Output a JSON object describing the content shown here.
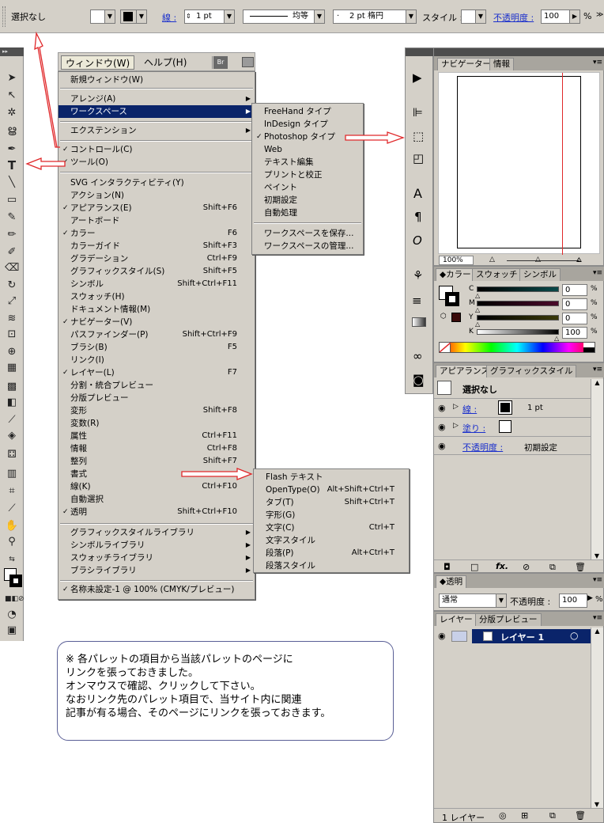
{
  "control_bar": {
    "selection_label": "選択なし",
    "stroke_label": "線 :",
    "stroke_weight": "1 pt",
    "profile_label": "均等",
    "brush_label": "2 pt 楕円",
    "style_label": "スタイル :",
    "opacity_label": "不透明度 :",
    "opacity_value": "100",
    "percent": "%"
  },
  "tools_header": "▸▸",
  "menubar": {
    "window_label": "ウィンドウ(W)",
    "help_label": "ヘルプ(H)",
    "bridge_label": "Br"
  },
  "window_menu": {
    "items": [
      {
        "label": "新規ウィンドウ(W)",
        "check": "",
        "shortcut": "",
        "sub": ""
      },
      {
        "label": "アレンジ(A)",
        "check": "",
        "shortcut": "",
        "sub": "▶"
      },
      {
        "label": "ワークスペース",
        "check": "",
        "shortcut": "",
        "sub": "▶"
      },
      {
        "label": "エクステンション",
        "check": "",
        "shortcut": "",
        "sub": "▶"
      },
      {
        "label": "コントロール(C)",
        "check": "✓",
        "shortcut": "",
        "sub": ""
      },
      {
        "label": "ツール(O)",
        "check": "✓",
        "shortcut": "",
        "sub": ""
      },
      {
        "label": "SVG インタラクティビティ(Y)",
        "check": "",
        "shortcut": "",
        "sub": ""
      },
      {
        "label": "アクション(N)",
        "check": "",
        "shortcut": "",
        "sub": ""
      },
      {
        "label": "アピアランス(E)",
        "check": "✓",
        "shortcut": "Shift+F6",
        "sub": ""
      },
      {
        "label": "アートボード",
        "check": "",
        "shortcut": "",
        "sub": ""
      },
      {
        "label": "カラー",
        "check": "✓",
        "shortcut": "F6",
        "sub": ""
      },
      {
        "label": "カラーガイド",
        "check": "",
        "shortcut": "Shift+F3",
        "sub": ""
      },
      {
        "label": "グラデーション",
        "check": "",
        "shortcut": "Ctrl+F9",
        "sub": ""
      },
      {
        "label": "グラフィックスタイル(S)",
        "check": "",
        "shortcut": "Shift+F5",
        "sub": ""
      },
      {
        "label": "シンボル",
        "check": "",
        "shortcut": "Shift+Ctrl+F11",
        "sub": ""
      },
      {
        "label": "スウォッチ(H)",
        "check": "",
        "shortcut": "",
        "sub": ""
      },
      {
        "label": "ドキュメント情報(M)",
        "check": "",
        "shortcut": "",
        "sub": ""
      },
      {
        "label": "ナビゲーター(V)",
        "check": "✓",
        "shortcut": "",
        "sub": ""
      },
      {
        "label": "パスファインダー(P)",
        "check": "",
        "shortcut": "Shift+Ctrl+F9",
        "sub": ""
      },
      {
        "label": "ブラシ(B)",
        "check": "",
        "shortcut": "F5",
        "sub": ""
      },
      {
        "label": "リンク(I)",
        "check": "",
        "shortcut": "",
        "sub": ""
      },
      {
        "label": "レイヤー(L)",
        "check": "✓",
        "shortcut": "F7",
        "sub": ""
      },
      {
        "label": "分割・統合プレビュー",
        "check": "",
        "shortcut": "",
        "sub": ""
      },
      {
        "label": "分版プレビュー",
        "check": "",
        "shortcut": "",
        "sub": ""
      },
      {
        "label": "変形",
        "check": "",
        "shortcut": "Shift+F8",
        "sub": ""
      },
      {
        "label": "変数(R)",
        "check": "",
        "shortcut": "",
        "sub": ""
      },
      {
        "label": "属性",
        "check": "",
        "shortcut": "Ctrl+F11",
        "sub": ""
      },
      {
        "label": "情報",
        "check": "",
        "shortcut": "Ctrl+F8",
        "sub": ""
      },
      {
        "label": "整列",
        "check": "",
        "shortcut": "Shift+F7",
        "sub": ""
      },
      {
        "label": "書式",
        "check": "",
        "shortcut": "",
        "sub": "▶"
      },
      {
        "label": "線(K)",
        "check": "",
        "shortcut": "Ctrl+F10",
        "sub": ""
      },
      {
        "label": "自動選択",
        "check": "",
        "shortcut": "",
        "sub": ""
      },
      {
        "label": "透明",
        "check": "✓",
        "shortcut": "Shift+Ctrl+F10",
        "sub": ""
      },
      {
        "label": "グラフィックスタイルライブラリ",
        "check": "",
        "shortcut": "",
        "sub": "▶"
      },
      {
        "label": "シンボルライブラリ",
        "check": "",
        "shortcut": "",
        "sub": "▶"
      },
      {
        "label": "スウォッチライブラリ",
        "check": "",
        "shortcut": "",
        "sub": "▶"
      },
      {
        "label": "ブラシライブラリ",
        "check": "",
        "shortcut": "",
        "sub": "▶"
      },
      {
        "label": "名称未設定-1 @ 100% (CMYK/プレビュー)",
        "check": "✓",
        "shortcut": "",
        "sub": ""
      }
    ]
  },
  "workspace_menu": {
    "items": [
      {
        "label": "FreeHand タイプ",
        "check": ""
      },
      {
        "label": "InDesign タイプ",
        "check": ""
      },
      {
        "label": "Photoshop タイプ",
        "check": "✓"
      },
      {
        "label": "Web",
        "check": ""
      },
      {
        "label": "テキスト編集",
        "check": ""
      },
      {
        "label": "プリントと校正",
        "check": ""
      },
      {
        "label": "ペイント",
        "check": ""
      },
      {
        "label": "初期設定",
        "check": ""
      },
      {
        "label": "自動処理",
        "check": ""
      },
      {
        "label": "ワークスペースを保存...",
        "check": ""
      },
      {
        "label": "ワークスペースの管理...",
        "check": ""
      }
    ]
  },
  "type_menu": {
    "items": [
      {
        "label": "Flash テキスト",
        "shortcut": ""
      },
      {
        "label": "OpenType(O)",
        "shortcut": "Alt+Shift+Ctrl+T"
      },
      {
        "label": "タブ(T)",
        "shortcut": "Shift+Ctrl+T"
      },
      {
        "label": "字形(G)",
        "shortcut": ""
      },
      {
        "label": "文字(C)",
        "shortcut": "Ctrl+T"
      },
      {
        "label": "文字スタイル",
        "shortcut": ""
      },
      {
        "label": "段落(P)",
        "shortcut": "Alt+Ctrl+T"
      },
      {
        "label": "段落スタイル",
        "shortcut": ""
      }
    ]
  },
  "navigator_panel": {
    "tab1": "ナビゲーター",
    "tab2": "情報",
    "zoom": "100%"
  },
  "color_panel": {
    "tab1": "◆カラー",
    "tab2": "スウォッチ",
    "tab3": "シンボル",
    "channels": [
      {
        "name": "C",
        "value": "0",
        "unit": "%"
      },
      {
        "name": "M",
        "value": "0",
        "unit": "%"
      },
      {
        "name": "Y",
        "value": "0",
        "unit": "%"
      },
      {
        "name": "K",
        "value": "100",
        "unit": "%"
      }
    ]
  },
  "appearance_panel": {
    "tab1": "アピアランス",
    "tab2": "グラフィックスタイル",
    "title": "選択なし",
    "stroke_label": "線 :",
    "stroke_value": "1 pt",
    "fill_label": "塗り :",
    "opacity_label": "不透明度 :",
    "opacity_value": "初期設定",
    "fx": "fx."
  },
  "transparency_panel": {
    "tab": "◆透明",
    "blend_mode": "通常",
    "opacity_label": "不透明度 :",
    "opacity_value": "100",
    "percent": "%"
  },
  "layers_panel": {
    "tab1": "レイヤー",
    "tab2": "分版プレビュー",
    "layer_name": "レイヤー 1",
    "footer": "1 レイヤー"
  },
  "note": {
    "lines": [
      "※ 各パレットの項目から当該パレットのページに",
      "リンクを張っておきました。",
      "オンマウスで確認、クリックして下さい。",
      "なおリンク先のパレット項目で、当サイト内に関連",
      "記事が有る場合、そのページにリンクを張っておきます。"
    ]
  },
  "colors": {
    "menu_highlight": "#0a246a",
    "arrow_red": "#e0282a",
    "panel_gray": "#d4d0c8",
    "link_blue": "#1a2fcc"
  }
}
